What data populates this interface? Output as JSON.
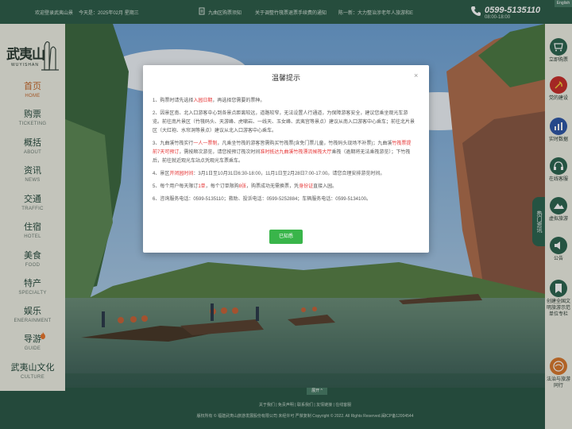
{
  "topbar": {
    "welcome": "欢迎登录武夷山景",
    "date": "今天是：2025年02月 星期三",
    "notice1": "九曲区购票须知",
    "notice2": "关于调整竹筏票退票手续费的通知",
    "notice3": "陈一新：大力整治涉老年人旅游和E",
    "phone": "0599-5135110",
    "hours": "08:00-18:00",
    "lang": "English"
  },
  "logo": {
    "text_cn": "武夷山",
    "text_en": "WUYISHAN"
  },
  "leftnav": [
    {
      "cn": "首页",
      "en": "HOME",
      "active": true
    },
    {
      "cn": "购票",
      "en": "TICKETING"
    },
    {
      "cn": "概括",
      "en": "ABOUT"
    },
    {
      "cn": "资讯",
      "en": "NEWS"
    },
    {
      "cn": "交通",
      "en": "TRAFFIC"
    },
    {
      "cn": "住宿",
      "en": "HOTEL"
    },
    {
      "cn": "美食",
      "en": "FOOD"
    },
    {
      "cn": "特产",
      "en": "SPECIALTY"
    },
    {
      "cn": "娱乐",
      "en": "ENERAINMENT"
    },
    {
      "cn": "导游",
      "en": "GUIDE"
    },
    {
      "cn": "武夷山文化",
      "en": "CULTURE"
    }
  ],
  "rightbar": [
    {
      "label": "立即购票",
      "icon": "cart-icon"
    },
    {
      "label": "党的建设",
      "icon": "party-icon"
    },
    {
      "label": "实时数据",
      "icon": "bar-chart-icon"
    },
    {
      "label": "在线客服",
      "icon": "headset-icon"
    },
    {
      "label": "虚拟旅游",
      "icon": "mountain-icon"
    },
    {
      "label": "公告",
      "icon": "speaker-icon"
    },
    {
      "label": "创建全国文明旅游示范单位专栏",
      "icon": "bookmark-icon"
    },
    {
      "label": "法治与旅游同行",
      "icon": "emblem-icon"
    }
  ],
  "hotspot_tab": "热门资讯",
  "modal": {
    "title": "温馨提示",
    "close": "×",
    "item1_a": "1、购票时请先选择",
    "item1_red": "入园日期",
    "item1_b": "，再选择您需要的票种。",
    "item2": "2、因景区南、北入口游客中心到各景点距离较远，道路较窄，无法设置人行通道，为保障游客安全，建议您乘坐观光车游览。前往南片景区（竹筏码头、天游峰、虎啸岩、一线天、玉女峰、武夷宫等景点）建议从南入口游客中心乘车；前往北片景区（大红袍、水帘洞等景点）建议从北入口游客中心乘车。",
    "item3_a": "3、九曲溪竹筏实行",
    "item3_red1": "一人一票制",
    "item3_b": "，凡乘坐竹筏的游客皆需购买竹筏票(含免门票儿童，竹筏码头现场不补票)；九曲溪",
    "item3_red2": "竹筏票提前7天可预订",
    "item3_c": "，需按顺次游览，请您按预订筏次时间",
    "item3_red3": "准时抵达九曲溪竹筏漂流候筏大厅",
    "item3_d": "乘筏（逾期将无法乘筏游览）；下竹筏后，前往就近观光车站点凭观光车票乘车。",
    "item4_a": "4、景区",
    "item4_red": "开闭园时间",
    "item4_b": "：3月1日至10月31日6:30-18:00，11月1日至2月28日7:00-17:00。请您合理安排游览时间。",
    "item5_a": "5、每个用户每天限订",
    "item5_red1": "1单",
    "item5_b": "，每个订单限购",
    "item5_red2": "8张",
    "item5_c": "，购票成功无需换票，凭",
    "item5_red3": "身份证",
    "item5_d": "直接入园。",
    "item6": "6、咨询服务电话：0599-5135110；救助、投诉电话：0599-5252884；车辆服务电话：0599-5134100。",
    "button": "已知悉"
  },
  "footer": {
    "expand": "展开 ^",
    "links": "关于我们  |  免责声明  |  联系我们  |  友情链接  |  在线客服",
    "copyright": "版权所有 © 福建武夷山旅游发展股份有限公司 未经许可 严禁复制 Copyright © 2022. All Rights Reserved.闽ICP备12004544"
  },
  "colors": {
    "primary": "#2f5f4b",
    "accent": "#c56a2d",
    "alert_red": "#e53333",
    "confirm_green": "#39b54a"
  }
}
